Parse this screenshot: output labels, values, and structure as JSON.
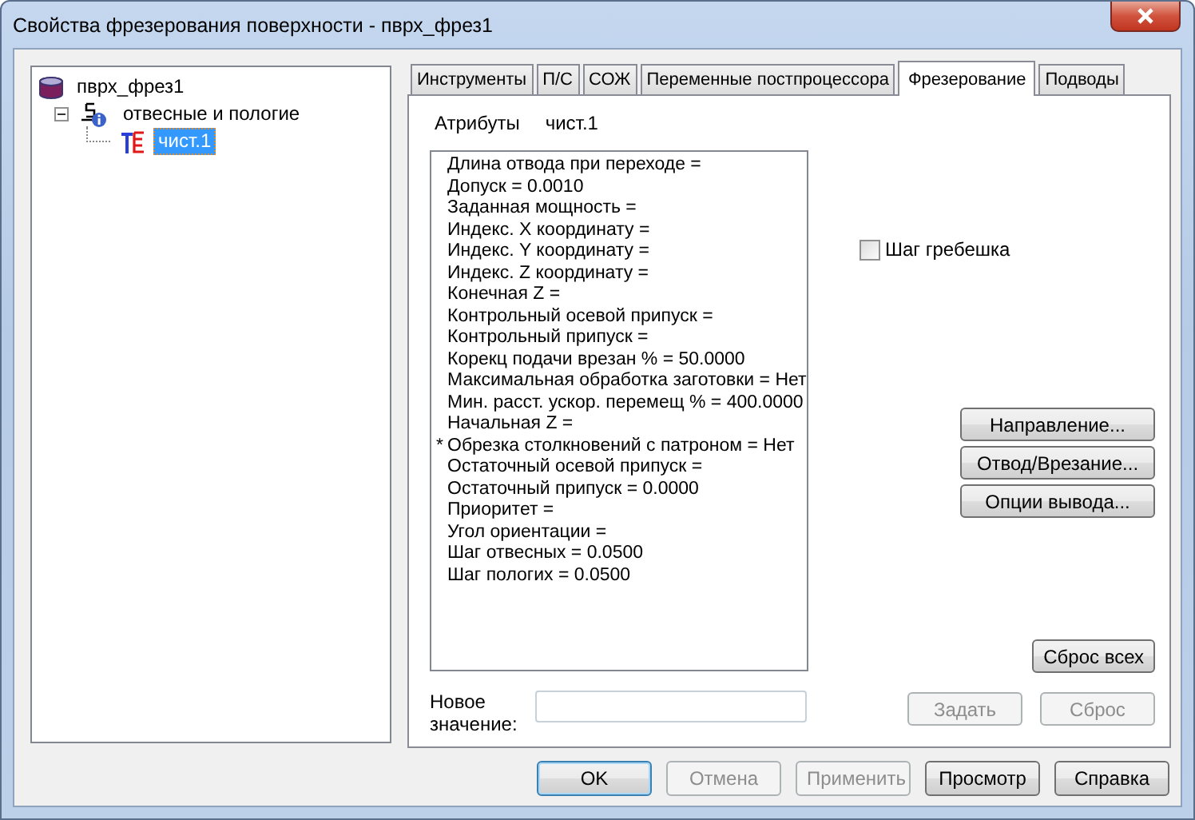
{
  "window": {
    "title": "Свойства фрезерования поверхности - пврх_фрез1"
  },
  "tree": [
    {
      "label": "пврх_фрез1",
      "kind": "database",
      "selected": false,
      "children": [
        {
          "label": "отвесные и пологие",
          "kind": "group",
          "selected": false,
          "expanded": true,
          "children": [
            {
              "label": "чист.1",
              "kind": "operation",
              "selected": true
            }
          ]
        }
      ]
    }
  ],
  "tabs": [
    {
      "label": "Инструменты",
      "selected": false
    },
    {
      "label": "П/С",
      "selected": false
    },
    {
      "label": "СОЖ",
      "selected": false
    },
    {
      "label": "Переменные постпроцессора",
      "selected": false
    },
    {
      "label": "Фрезерование",
      "selected": true
    },
    {
      "label": "Подводы",
      "selected": false
    }
  ],
  "attributes": {
    "label": "Атрибуты",
    "value": "чист.1"
  },
  "attribute_list": [
    {
      "text": "Длина отвода при переходе ="
    },
    {
      "text": "Допуск = 0.0010"
    },
    {
      "text": "Заданная мощность ="
    },
    {
      "text": "Индекс. X координату ="
    },
    {
      "text": "Индекс. Y координату ="
    },
    {
      "text": "Индекс. Z координату ="
    },
    {
      "text": "Конечная Z ="
    },
    {
      "text": "Контрольный осевой припуск ="
    },
    {
      "text": "Контрольный припуск ="
    },
    {
      "text": "Корекц подачи врезан % = 50.0000"
    },
    {
      "text": "Максимальная обработка заготовки = Нет"
    },
    {
      "text": "Мин. расст. ускор. перемещ % = 400.0000"
    },
    {
      "text": "Начальная Z ="
    },
    {
      "text": "Обрезка столкновений с патроном = Нет",
      "marker": "*"
    },
    {
      "text": "Остаточный осевой припуск ="
    },
    {
      "text": "Остаточный припуск = 0.0000"
    },
    {
      "text": "Приоритет ="
    },
    {
      "text": "Угол ориентации ="
    },
    {
      "text": "Шаг отвесных = 0.0500"
    },
    {
      "text": "Шаг пологих = 0.0500"
    }
  ],
  "scallop_checkbox": {
    "label": "Шаг гребешка",
    "checked": false
  },
  "side_buttons": [
    {
      "label": "Направление...",
      "disabled": false
    },
    {
      "label": "Отвод/Врезание...",
      "disabled": false
    },
    {
      "label": "Опции вывода...",
      "disabled": false
    }
  ],
  "reset_all_button": {
    "label": "Сброс всех",
    "disabled": false
  },
  "new_value": {
    "label": "Новое значение:"
  },
  "value_buttons": [
    {
      "label": "Задать",
      "disabled": true
    },
    {
      "label": "Сброс",
      "disabled": true
    }
  ],
  "dialog_buttons": [
    {
      "label": "OK",
      "disabled": false,
      "default": true
    },
    {
      "label": "Отмена",
      "disabled": true,
      "default": false
    },
    {
      "label": "Применить",
      "disabled": true,
      "default": false
    },
    {
      "label": "Просмотр",
      "disabled": false,
      "default": false
    },
    {
      "label": "Справка",
      "disabled": false,
      "default": false
    }
  ]
}
